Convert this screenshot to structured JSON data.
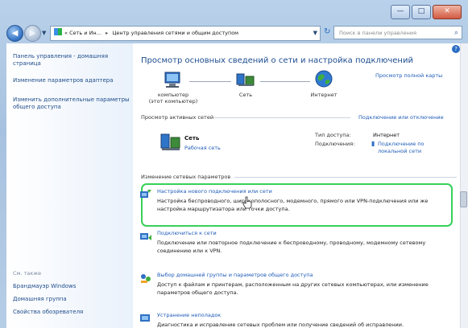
{
  "window": {
    "address": {
      "segments": [
        "Сеть и Ин...",
        "Центр управления сетями и общим доступом"
      ],
      "prefix": "«"
    },
    "search_placeholder": "Поиск в панели управления"
  },
  "left_pane": {
    "links": [
      "Панель управления - домашняя страница",
      "Изменение параметров адаптера",
      "Изменить дополнительные параметры общего доступа"
    ],
    "see_also_title": "См. также",
    "see_also": [
      "Брандмауэр Windows",
      "Домашняя группа",
      "Свойства обозревателя"
    ]
  },
  "main": {
    "title": "Просмотр основных сведений о сети и настройка подключений",
    "full_map_link": "Просмотр полной карты",
    "map": {
      "computer": "компьютер",
      "computer_sub": "(этот компьютер)",
      "network": "Сеть",
      "internet": "Интернет"
    },
    "active_title": "Просмотр активных сетей",
    "connect_link": "Подключение или отключение",
    "active": {
      "name": "Сеть",
      "type": "Рабочая сеть",
      "access_label": "Тип доступа:",
      "access_value": "Интернет",
      "connections_label": "Подключения:",
      "connections_value": "Подключение по локальной сети"
    },
    "change_title": "Изменение сетевых параметров",
    "tasks": [
      {
        "link": "Настройка нового подключения или сети",
        "desc": "Настройка беспроводного, широкополосного, модемного, прямого или VPN-подключения или же настройка маршрутизатора или точки доступа."
      },
      {
        "link": "Подключиться к сети",
        "desc": "Подключение или повторное подключение к беспроводному, проводному, модемному сетевому соединению или к VPN."
      },
      {
        "link": "Выбор домашней группы и параметров общего доступа",
        "desc": "Доступ к файлам и принтерам, расположенным на других сетевых компьютерах, или изменение параметров общего доступа."
      },
      {
        "link": "Устранение неполадок",
        "desc": "Диагностика и исправление сетевых проблем или получение сведений об исправлении."
      }
    ]
  }
}
